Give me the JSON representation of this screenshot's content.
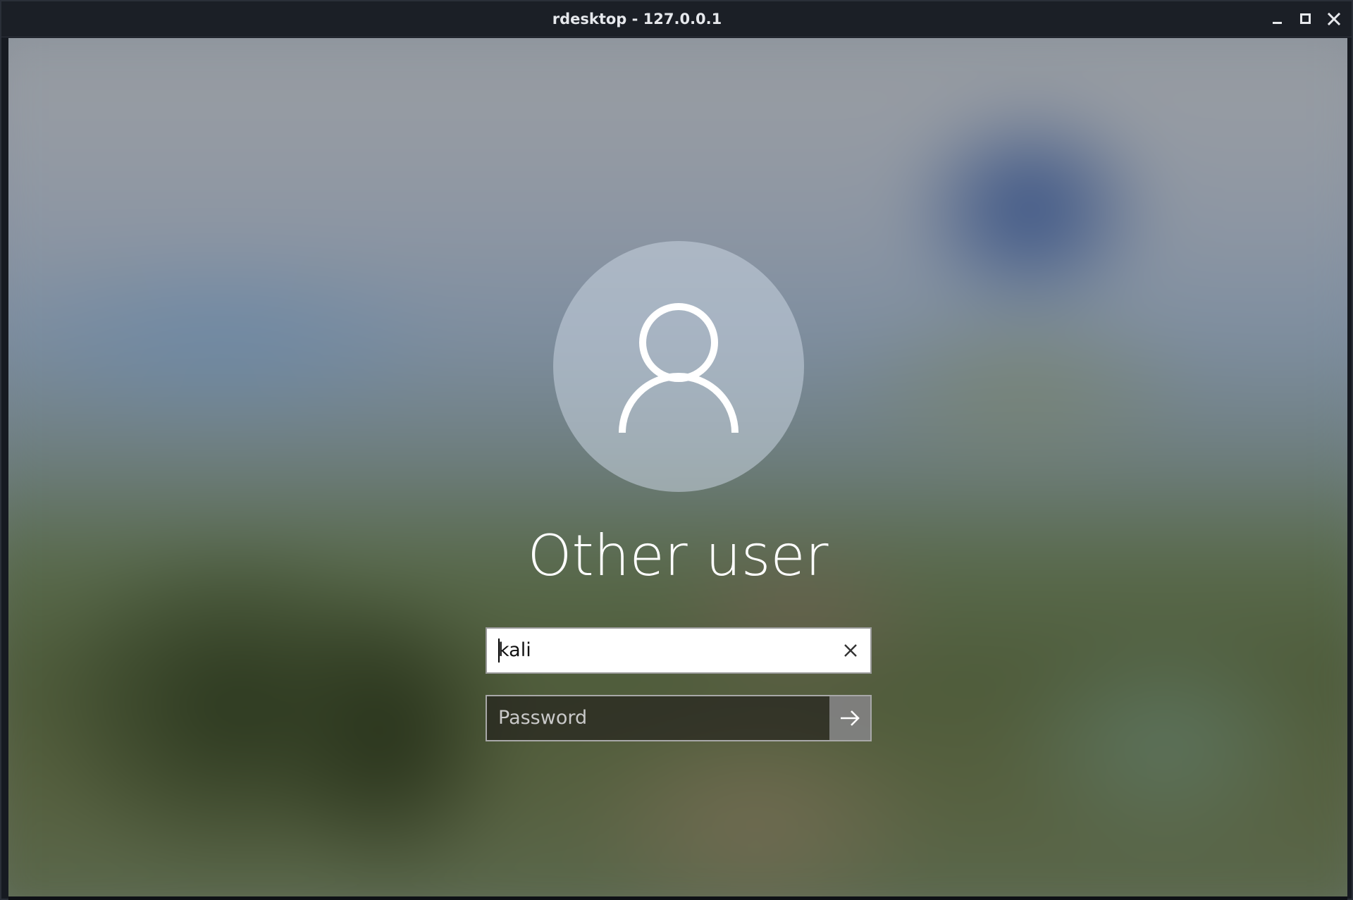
{
  "window": {
    "title": "rdesktop - 127.0.0.1",
    "controls": [
      "minimize-icon",
      "maximize-icon",
      "close-icon"
    ]
  },
  "login": {
    "avatar_icon": "user-icon",
    "username_label": "Other user",
    "username_value": "kali",
    "username_clear_icon": "clear-x-icon",
    "password_placeholder": "Password",
    "submit_icon": "arrow-right-icon"
  },
  "colors": {
    "titlebar_bg": "#1b1f26",
    "field_bg": "#ffffff",
    "password_bg": "#2a2826",
    "submit_bg": "#8c8c8c"
  }
}
